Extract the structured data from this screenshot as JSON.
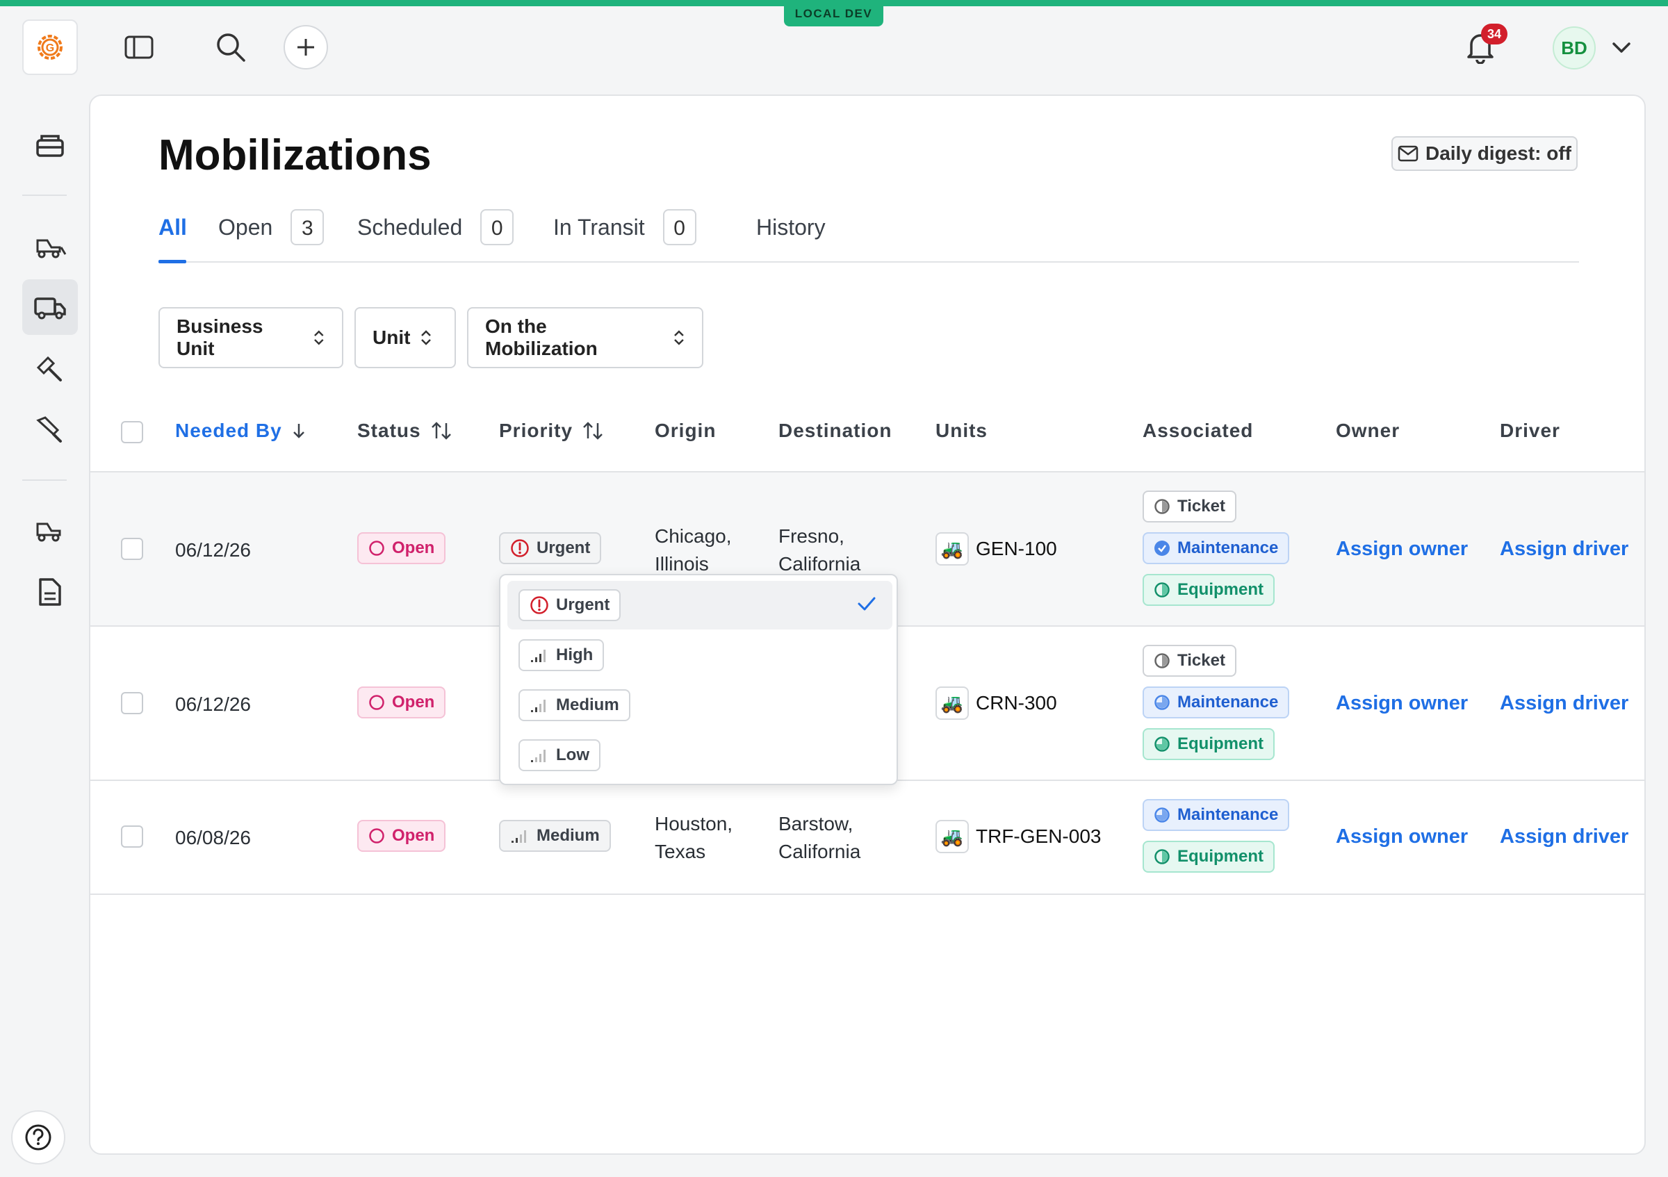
{
  "env_badge": "LOCAL DEV",
  "notifications": {
    "count": "34"
  },
  "user": {
    "initials": "BD"
  },
  "page": {
    "title": "Mobilizations",
    "digest_label": "Daily digest: off"
  },
  "tabs": [
    {
      "label": "All",
      "count": ""
    },
    {
      "label": "Open",
      "count": "3"
    },
    {
      "label": "Scheduled",
      "count": "0"
    },
    {
      "label": "In Transit",
      "count": "0"
    },
    {
      "label": "History",
      "count": ""
    }
  ],
  "filters": [
    "Business Unit",
    "Unit",
    "On the Mobilization"
  ],
  "columns": [
    "Needed By",
    "Status",
    "Priority",
    "Origin",
    "Destination",
    "Units",
    "Associated",
    "Owner",
    "Driver"
  ],
  "rows": [
    {
      "needed_by": "06/12/26",
      "status": "Open",
      "priority": "Urgent",
      "origin_city": "Chicago,",
      "origin_state": "Illinois",
      "dest_city": "Fresno,",
      "dest_state": "California",
      "unit": "GEN-100",
      "associated": [
        "Ticket",
        "Maintenance",
        "Equipment"
      ],
      "owner": "Assign owner",
      "driver": "Assign driver"
    },
    {
      "needed_by": "06/12/26",
      "status": "Open",
      "priority": "",
      "origin_city": "",
      "origin_state": "",
      "dest_city": "",
      "dest_state": "",
      "unit": "CRN-300",
      "associated": [
        "Ticket",
        "Maintenance",
        "Equipment"
      ],
      "owner": "Assign owner",
      "driver": "Assign driver"
    },
    {
      "needed_by": "06/08/26",
      "status": "Open",
      "priority": "Medium",
      "origin_city": "Houston,",
      "origin_state": "Texas",
      "dest_city": "Barstow,",
      "dest_state": "California",
      "unit": "TRF-GEN-003",
      "associated": [
        "Maintenance",
        "Equipment"
      ],
      "owner": "Assign owner",
      "driver": "Assign driver"
    }
  ],
  "priority_dropdown": {
    "options": [
      "Urgent",
      "High",
      "Medium",
      "Low"
    ],
    "selected": "Urgent"
  },
  "colors": {
    "accent": "#1f6fe5",
    "env_green": "#1fb37c",
    "status_open": "#d0216b",
    "urgent_red": "#d21f2b",
    "maintenance": "#1f5fd0",
    "equipment": "#12906a"
  },
  "icons": {
    "logo": "gear-logo-icon",
    "sidebar_toggle": "sidebar-panel-icon",
    "search": "search-icon",
    "add": "plus-icon",
    "bell": "bell-icon",
    "chevron": "chevron-down-icon",
    "help": "question-mark-icon"
  }
}
